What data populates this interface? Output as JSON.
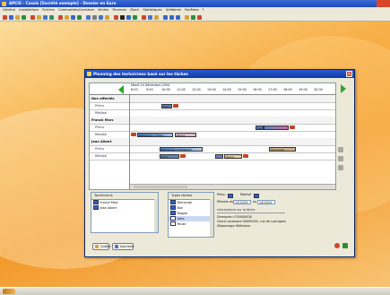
{
  "app": {
    "title": "APCIS - Cassis [Société exemple] - Dossier en Euro",
    "menu": [
      "Général",
      "Installations",
      "Fichiers",
      "Commandes/Livraison",
      "Ventes",
      "Finances",
      "Stock",
      "Statistiques",
      "Utilitaires",
      "Fenêtres",
      "?"
    ]
  },
  "dialog": {
    "title": "Planning des techniciens basé sur les tâches",
    "date": "Mardi 14 Décembre 2004",
    "hours": [
      "8:00",
      "9:00",
      "10:00",
      "11:00",
      "12:00",
      "13:00",
      "14:00",
      "15:00",
      "16:00",
      "17:00",
      "18:00",
      "19:00",
      "20:00"
    ],
    "rows": [
      {
        "label": "Non affectés",
        "kind": "group"
      },
      {
        "label": "Prévu",
        "kind": "sub"
      },
      {
        "label": "Réalisé",
        "kind": "sub"
      },
      {
        "label": "Franck Marc",
        "kind": "group"
      },
      {
        "label": "Prévu",
        "kind": "sub"
      },
      {
        "label": "Réalisé",
        "kind": "sub"
      },
      {
        "label": "Jean Albert",
        "kind": "group"
      },
      {
        "label": "Prévu",
        "kind": "sub"
      },
      {
        "label": "Réalisé",
        "kind": "sub"
      }
    ],
    "bars": {
      "b1": "Dem.",
      "b2": "Dém.",
      "b3": "Demande n°0000...",
      "b4": "Panne",
      "b5": "Demande n°00000057",
      "b6": "Demande",
      "b7": "Dem.",
      "b8": "Panne"
    },
    "techniciens": {
      "header": "Techniciens",
      "items": [
        {
          "label": "Franck Marc",
          "checked": true
        },
        {
          "label": "Jean Albert",
          "checked": true
        }
      ]
    },
    "types": {
      "header": "Types tâches",
      "items": [
        {
          "label": "Demande",
          "checked": true
        },
        {
          "label": "Bon",
          "checked": true
        },
        {
          "label": "Rappel",
          "checked": true
        },
        {
          "label": "Note",
          "checked": false
        },
        {
          "label": "Pause",
          "checked": false
        }
      ]
    },
    "filters": {
      "prevu_label": "Prévu",
      "realise_label": "Réalisé",
      "periode_label": "Période du",
      "from": "14/12/04",
      "au_label": "au",
      "to": "14/12/04"
    },
    "task_info": {
      "header": "Informations sur la tâche",
      "line1": "Demande n°00000008",
      "line2": "Client Lacomore 00000002, rue de Lauragais",
      "line3": "Dépannage téléviseur"
    },
    "buttons": {
      "quit": "Quitter",
      "print": "Imprimer"
    }
  }
}
